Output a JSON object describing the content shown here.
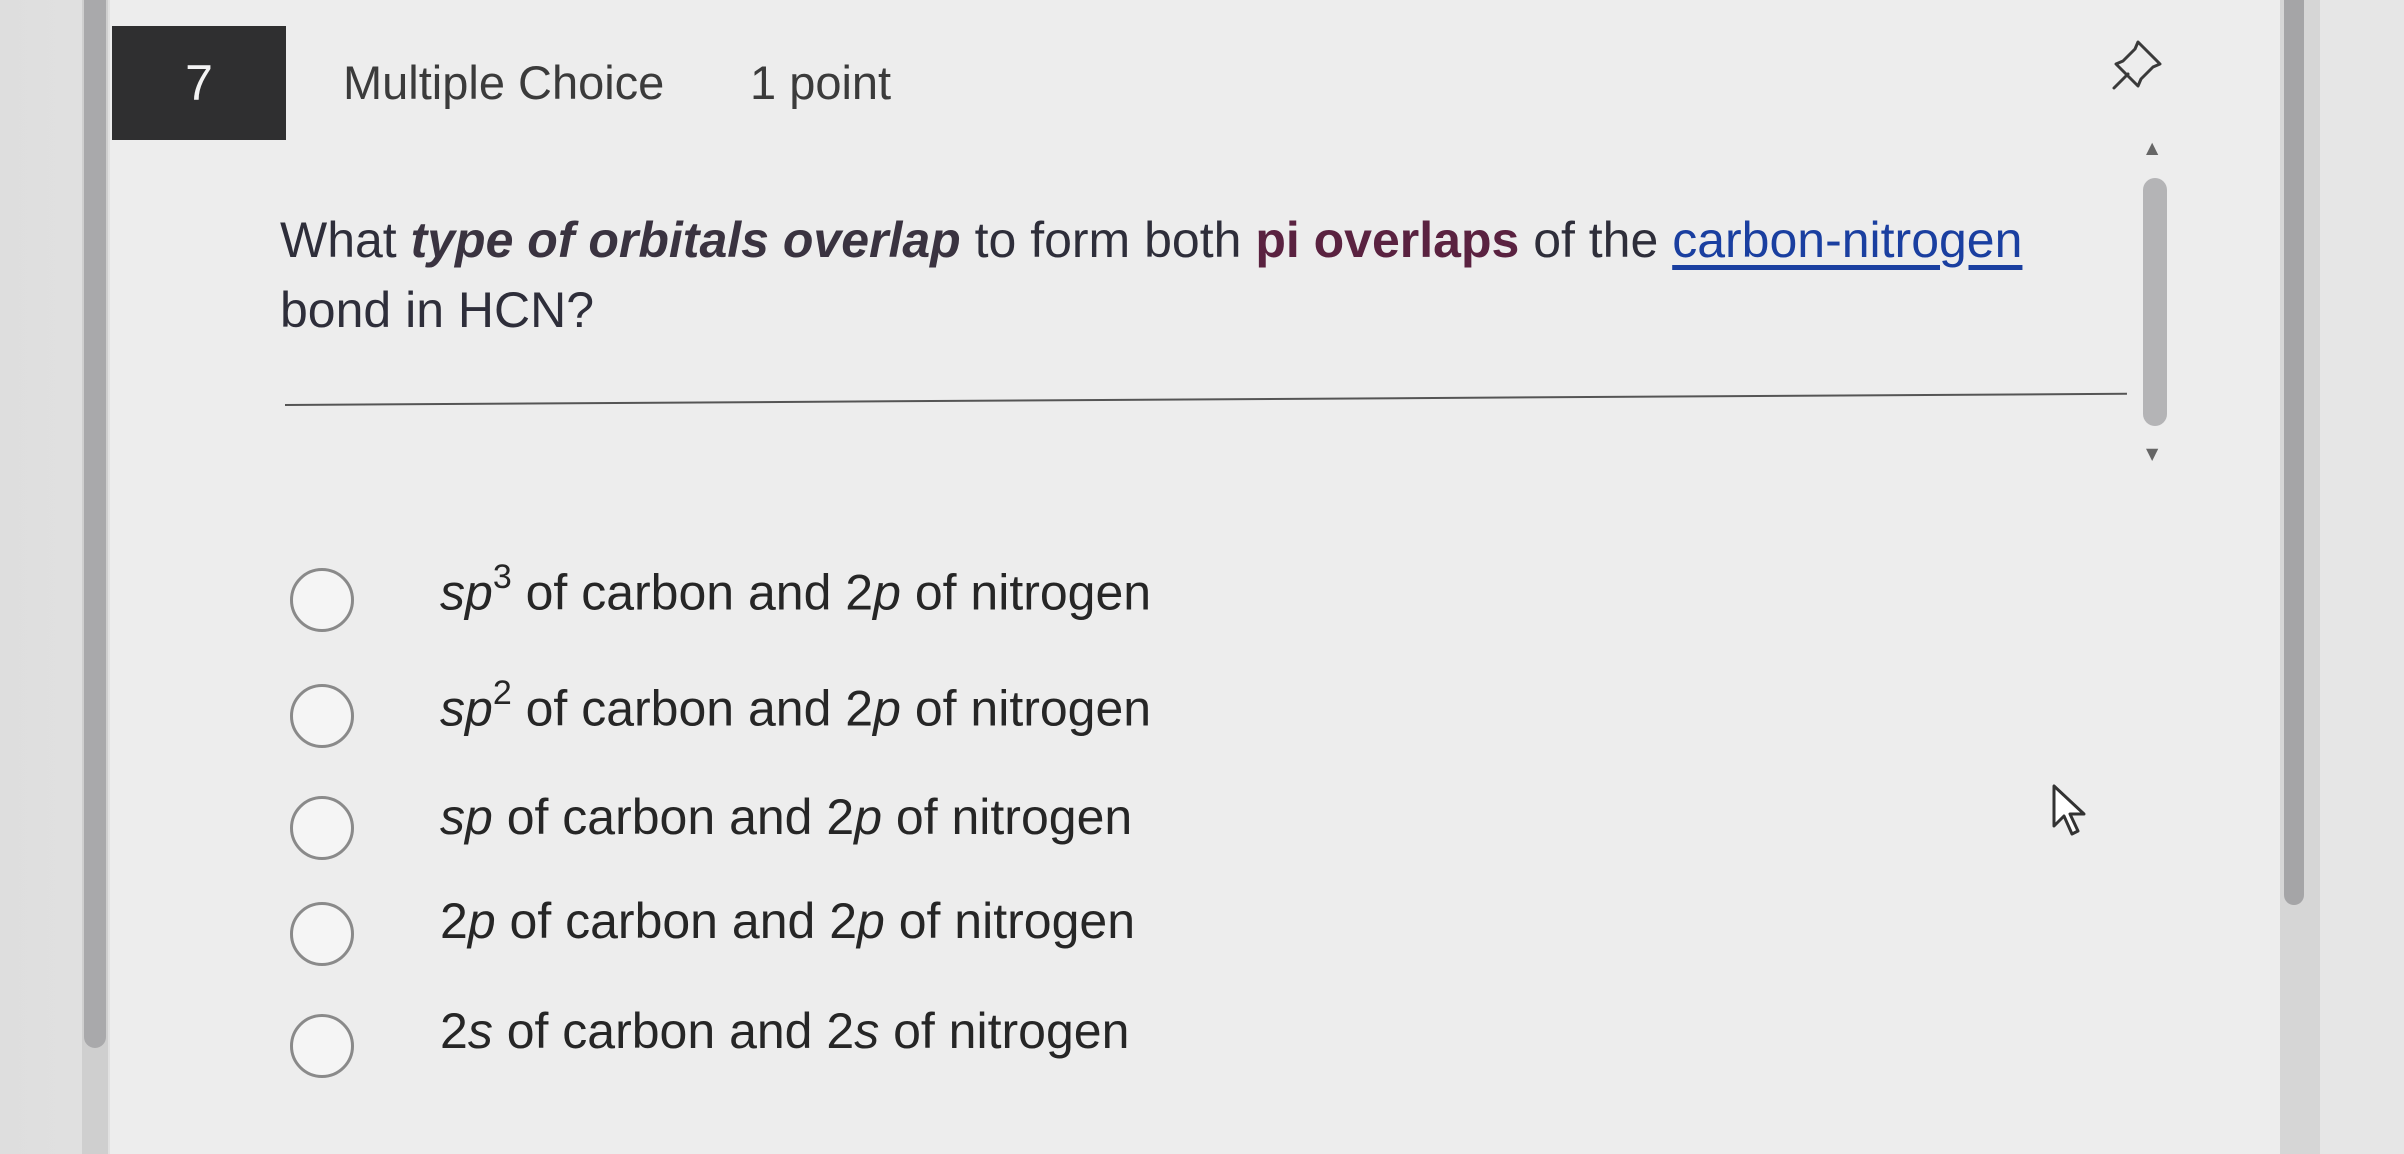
{
  "question_header": {
    "number": "7",
    "type": "Multiple Choice",
    "points": "1 point"
  },
  "question": {
    "part1": "What ",
    "emphasis": "type of orbitals overlap",
    "part2": " to form both ",
    "pi_term": "pi overlaps",
    "part3": " of the ",
    "link_text": "carbon-nitrogen",
    "part4": " bond in HCN?"
  },
  "options": [
    {
      "orb1": "sp",
      "sup": "3",
      "mid": " of carbon and 2",
      "orb2": "p",
      "end": " of nitrogen"
    },
    {
      "orb1": "sp",
      "sup": "2",
      "mid": " of carbon and 2",
      "orb2": "p",
      "end": " of nitrogen"
    },
    {
      "orb1": "sp",
      "sup": "",
      "mid": " of carbon and 2",
      "orb2": "p",
      "end": " of nitrogen"
    },
    {
      "pre": "2",
      "orb1": "p",
      "sup": "",
      "mid": " of carbon and 2",
      "orb2": "p",
      "end": " of nitrogen"
    },
    {
      "pre": "2",
      "orb1": "s",
      "sup": "",
      "mid": " of carbon and 2",
      "orb2": "s",
      "end": " of nitrogen"
    }
  ],
  "icons": {
    "pin": "pin-icon",
    "cursor": "mouse-pointer-icon"
  }
}
